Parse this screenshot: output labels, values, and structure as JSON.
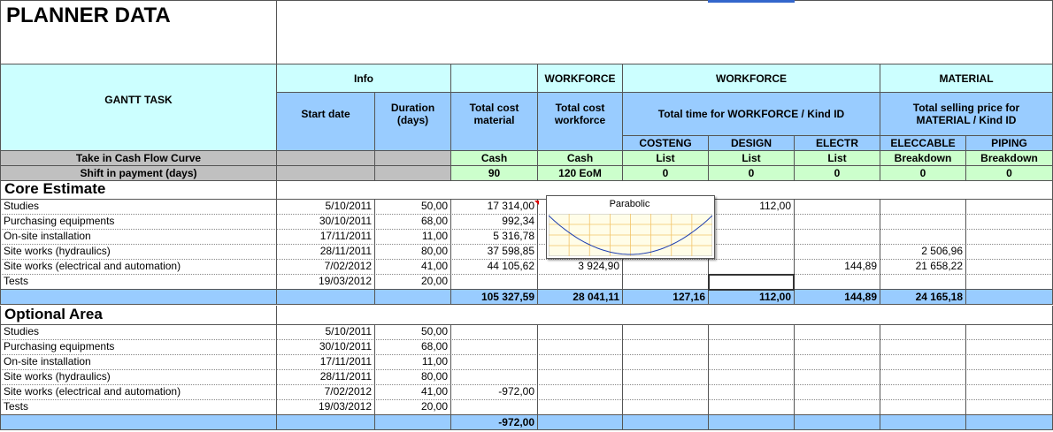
{
  "title": "PLANNER DATA",
  "header": {
    "gantt_task": "GANTT TASK",
    "info": "Info",
    "start_date": "Start date",
    "duration": "Duration (days)",
    "total_cost_material": "Total cost material",
    "workforce_a": "WORKFORCE",
    "total_cost_workforce": "Total cost workforce",
    "workforce_b": "WORKFORCE",
    "total_time": "Total time for WORKFORCE / Kind ID",
    "material": "MATERIAL",
    "total_selling": "Total selling price for MATERIAL / Kind ID",
    "kind_ids": [
      "COSTENG",
      "DESIGN",
      "ELECTR",
      "ELECCABLE",
      "PIPING"
    ]
  },
  "cashflow_row": {
    "label": "Take in Cash Flow Curve",
    "values": [
      "Cash",
      "Cash",
      "List",
      "List",
      "List",
      "Breakdown",
      "Breakdown"
    ]
  },
  "shift_row": {
    "label": "Shift in payment (days)",
    "values": [
      "90",
      "120 EoM",
      "0",
      "0",
      "0",
      "0",
      "0"
    ]
  },
  "core": {
    "title": "Core Estimate",
    "rows": [
      {
        "task": "Studies",
        "start": "5/10/2011",
        "duration": "50,00",
        "material": "17 314,00",
        "workforce": "",
        "costeng": "",
        "design": "112,00",
        "electr": "",
        "eleccable": "",
        "piping": ""
      },
      {
        "task": "Purchasing equipments",
        "start": "30/10/2011",
        "duration": "68,00",
        "material": "992,34",
        "workforce": "",
        "costeng": "",
        "design": "",
        "electr": "",
        "eleccable": "",
        "piping": ""
      },
      {
        "task": "On-site installation",
        "start": "17/11/2011",
        "duration": "11,00",
        "material": "5 316,78",
        "workforce": "",
        "costeng": "",
        "design": "",
        "electr": "",
        "eleccable": "",
        "piping": ""
      },
      {
        "task": "Site works (hydraulics)",
        "start": "28/11/2011",
        "duration": "80,00",
        "material": "37 598,85",
        "workforce": "",
        "costeng": "",
        "design": "",
        "electr": "",
        "eleccable": "2 506,96",
        "piping": ""
      },
      {
        "task": "Site works (electrical and automation)",
        "start": "7/02/2012",
        "duration": "41,00",
        "material": "44 105,62",
        "workforce": "3 924,90",
        "costeng": "",
        "design": "",
        "electr": "144,89",
        "eleccable": "21 658,22",
        "piping": ""
      },
      {
        "task": "Tests",
        "start": "19/03/2012",
        "duration": "20,00",
        "material": "",
        "workforce": "",
        "costeng": "",
        "design": "",
        "electr": "",
        "eleccable": "",
        "piping": ""
      }
    ],
    "totals": {
      "material": "105 327,59",
      "workforce": "28 041,11",
      "costeng": "127,16",
      "design": "112,00",
      "electr": "144,89",
      "eleccable": "24 165,18",
      "piping": ""
    }
  },
  "optional": {
    "title": "Optional Area",
    "rows": [
      {
        "task": "Studies",
        "start": "5/10/2011",
        "duration": "50,00",
        "material": "",
        "workforce": "",
        "costeng": "",
        "design": "",
        "electr": "",
        "eleccable": "",
        "piping": ""
      },
      {
        "task": "Purchasing equipments",
        "start": "30/10/2011",
        "duration": "68,00",
        "material": "",
        "workforce": "",
        "costeng": "",
        "design": "",
        "electr": "",
        "eleccable": "",
        "piping": ""
      },
      {
        "task": "On-site installation",
        "start": "17/11/2011",
        "duration": "11,00",
        "material": "",
        "workforce": "",
        "costeng": "",
        "design": "",
        "electr": "",
        "eleccable": "",
        "piping": ""
      },
      {
        "task": "Site works (hydraulics)",
        "start": "28/11/2011",
        "duration": "80,00",
        "material": "",
        "workforce": "",
        "costeng": "",
        "design": "",
        "electr": "",
        "eleccable": "",
        "piping": ""
      },
      {
        "task": "Site works (electrical and automation)",
        "start": "7/02/2012",
        "duration": "41,00",
        "material": "-972,00",
        "workforce": "",
        "costeng": "",
        "design": "",
        "electr": "",
        "eleccable": "",
        "piping": ""
      },
      {
        "task": "Tests",
        "start": "19/03/2012",
        "duration": "20,00",
        "material": "",
        "workforce": "",
        "costeng": "",
        "design": "",
        "electr": "",
        "eleccable": "",
        "piping": ""
      }
    ],
    "totals": {
      "material": "-972,00",
      "workforce": "",
      "costeng": "",
      "design": "",
      "electr": "",
      "eleccable": "",
      "piping": ""
    }
  },
  "popup": {
    "label": "Parabolic",
    "curve_color": "#1f3fb0",
    "grid_color": "#f2c46a",
    "bg_color": "#fffde8"
  },
  "colors": {
    "cyan": "#ccffff",
    "blue": "#99ccff",
    "green": "#ccffcc",
    "grey": "#c0c0c0"
  }
}
